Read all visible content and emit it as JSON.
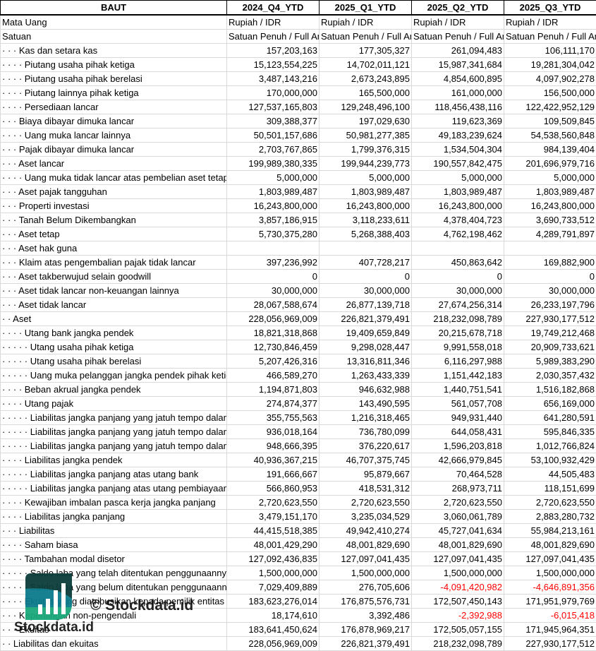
{
  "sheet": {
    "title": "BAUT",
    "columns": [
      "2024_Q4_YTD",
      "2025_Q1_YTD",
      "2025_Q2_YTD",
      "2025_Q3_YTD"
    ],
    "meta_rows": [
      {
        "label": "Mata Uang",
        "values": [
          "Rupiah / IDR",
          "Rupiah / IDR",
          "Rupiah / IDR",
          "Rupiah / IDR"
        ]
      },
      {
        "label": "Satuan",
        "values": [
          "Satuan Penuh / Full Amount",
          "Satuan Penuh / Full Amount",
          "Satuan Penuh / Full Amount",
          "Satuan Penuh / Full Amount"
        ]
      }
    ],
    "rows": [
      {
        "label": "· · · Kas dan setara kas",
        "values": [
          "157,203,163",
          "177,305,327",
          "261,094,483",
          "106,111,170"
        ]
      },
      {
        "label": "· · · · Piutang usaha pihak ketiga",
        "values": [
          "15,123,554,225",
          "14,702,011,121",
          "15,987,341,684",
          "19,281,304,042"
        ]
      },
      {
        "label": "· · · · Piutang usaha pihak berelasi",
        "values": [
          "3,487,143,216",
          "2,673,243,895",
          "4,854,600,895",
          "4,097,902,278"
        ]
      },
      {
        "label": "· · · · Piutang lainnya pihak ketiga",
        "values": [
          "170,000,000",
          "165,500,000",
          "161,000,000",
          "156,500,000"
        ]
      },
      {
        "label": "· · · · Persediaan lancar",
        "values": [
          "127,537,165,803",
          "129,248,496,100",
          "118,456,438,116",
          "122,422,952,129"
        ]
      },
      {
        "label": "· · · Biaya dibayar dimuka lancar",
        "values": [
          "309,388,377",
          "197,029,630",
          "119,623,369",
          "109,509,845"
        ]
      },
      {
        "label": "· · · · Uang muka lancar lainnya",
        "values": [
          "50,501,157,686",
          "50,981,277,385",
          "49,183,239,624",
          "54,538,560,848"
        ]
      },
      {
        "label": "· · · Pajak dibayar dimuka lancar",
        "values": [
          "2,703,767,865",
          "1,799,376,315",
          "1,534,504,304",
          "984,139,404"
        ]
      },
      {
        "label": "· · · Aset lancar",
        "values": [
          "199,989,380,335",
          "199,944,239,773",
          "190,557,842,475",
          "201,696,979,716"
        ]
      },
      {
        "label": "· · · · Uang muka tidak lancar atas pembelian aset tetap",
        "values": [
          "5,000,000",
          "5,000,000",
          "5,000,000",
          "5,000,000"
        ]
      },
      {
        "label": "· · · Aset pajak tangguhan",
        "values": [
          "1,803,989,487",
          "1,803,989,487",
          "1,803,989,487",
          "1,803,989,487"
        ]
      },
      {
        "label": "· · · Properti investasi",
        "values": [
          "16,243,800,000",
          "16,243,800,000",
          "16,243,800,000",
          "16,243,800,000"
        ]
      },
      {
        "label": "· · · Tanah Belum Dikembangkan",
        "values": [
          "3,857,186,915",
          "3,118,233,611",
          "4,378,404,723",
          "3,690,733,512"
        ]
      },
      {
        "label": "· · · Aset tetap",
        "values": [
          "5,730,375,280",
          "5,268,388,403",
          "4,762,198,462",
          "4,289,791,897"
        ]
      },
      {
        "label": "· · · Aset hak guna",
        "values": [
          "",
          "",
          "",
          ""
        ]
      },
      {
        "label": "· · · Klaim atas pengembalian pajak tidak lancar",
        "values": [
          "397,236,992",
          "407,728,217",
          "450,863,642",
          "169,882,900"
        ]
      },
      {
        "label": "· · · Aset takberwujud selain goodwill",
        "values": [
          "0",
          "0",
          "0",
          "0"
        ]
      },
      {
        "label": "· · · Aset tidak lancar non-keuangan lainnya",
        "values": [
          "30,000,000",
          "30,000,000",
          "30,000,000",
          "30,000,000"
        ]
      },
      {
        "label": "· · · Aset tidak lancar",
        "values": [
          "28,067,588,674",
          "26,877,139,718",
          "27,674,256,314",
          "26,233,197,796"
        ]
      },
      {
        "label": "· · Aset",
        "values": [
          "228,056,969,009",
          "226,821,379,491",
          "218,232,098,789",
          "227,930,177,512"
        ]
      },
      {
        "label": "· · · · Utang bank jangka pendek",
        "values": [
          "18,821,318,868",
          "19,409,659,849",
          "20,215,678,718",
          "19,749,212,468"
        ]
      },
      {
        "label": "· · · · · Utang usaha pihak ketiga",
        "values": [
          "12,730,846,459",
          "9,298,028,447",
          "9,991,558,018",
          "20,909,733,621"
        ]
      },
      {
        "label": "· · · · · Utang usaha pihak berelasi",
        "values": [
          "5,207,426,316",
          "13,316,811,346",
          "6,116,297,988",
          "5,989,383,290"
        ]
      },
      {
        "label": "· · · · · Uang muka pelanggan jangka pendek pihak ketiga",
        "values": [
          "466,589,270",
          "1,263,433,339",
          "1,151,442,183",
          "2,030,357,432"
        ]
      },
      {
        "label": "· · · · Beban akrual jangka pendek",
        "values": [
          "1,194,871,803",
          "946,632,988",
          "1,440,751,541",
          "1,516,182,868"
        ]
      },
      {
        "label": "· · · · Utang pajak",
        "values": [
          "274,874,377",
          "143,490,595",
          "561,057,708",
          "656,169,000"
        ]
      },
      {
        "label": "· · · · · Liabilitas jangka panjang yang jatuh tempo dalam satu tahun",
        "values": [
          "355,755,563",
          "1,216,318,465",
          "949,931,440",
          "641,280,591"
        ]
      },
      {
        "label": "· · · · · Liabilitas jangka panjang yang jatuh tempo dalam satu tahun",
        "values": [
          "936,018,164",
          "736,780,099",
          "644,058,431",
          "595,846,335"
        ]
      },
      {
        "label": "· · · · · Liabilitas jangka panjang yang jatuh tempo dalam satu tahun",
        "values": [
          "948,666,395",
          "376,220,617",
          "1,596,203,818",
          "1,012,766,824"
        ]
      },
      {
        "label": "· · · · Liabilitas jangka pendek",
        "values": [
          "40,936,367,215",
          "46,707,375,745",
          "42,666,979,845",
          "53,100,932,429"
        ]
      },
      {
        "label": "· · · · · Liabilitas jangka panjang atas utang bank",
        "values": [
          "191,666,667",
          "95,879,667",
          "70,464,528",
          "44,505,483"
        ]
      },
      {
        "label": "· · · · · Liabilitas jangka panjang atas utang pembiayaan",
        "values": [
          "566,860,953",
          "418,531,312",
          "268,973,711",
          "118,151,699"
        ]
      },
      {
        "label": "· · · · Kewajiban imbalan pasca kerja jangka panjang",
        "values": [
          "2,720,623,550",
          "2,720,623,550",
          "2,720,623,550",
          "2,720,623,550"
        ]
      },
      {
        "label": "· · · · Liabilitas jangka panjang",
        "values": [
          "3,479,151,170",
          "3,235,034,529",
          "3,060,061,789",
          "2,883,280,732"
        ]
      },
      {
        "label": "· · · Liabilitas",
        "values": [
          "44,415,518,385",
          "49,942,410,274",
          "45,727,041,634",
          "55,984,213,161"
        ]
      },
      {
        "label": "· · · · Saham biasa",
        "values": [
          "48,001,429,290",
          "48,001,829,690",
          "48,001,829,690",
          "48,001,829,690"
        ]
      },
      {
        "label": "· · · · Tambahan modal disetor",
        "values": [
          "127,092,436,835",
          "127,097,041,435",
          "127,097,041,435",
          "127,097,041,435"
        ]
      },
      {
        "label": "· · · · · Saldo laba yang telah ditentukan penggunaannya",
        "values": [
          "1,500,000,000",
          "1,500,000,000",
          "1,500,000,000",
          "1,500,000,000"
        ]
      },
      {
        "label": "· · · · · Saldo laba yang belum ditentukan penggunaannya",
        "values": [
          "7,029,409,889",
          "276,705,606",
          "-4,091,420,982",
          "-4,646,891,356"
        ]
      },
      {
        "label": "· · · · Ekuitas yang diatribusikan kepada pemilik entitas induk",
        "values": [
          "183,623,276,014",
          "176,875,576,731",
          "172,507,450,143",
          "171,951,979,769"
        ]
      },
      {
        "label": "· · · Kepentingan non-pengendali",
        "values": [
          "18,174,610",
          "3,392,486",
          "-2,392,988",
          "-6,015,418"
        ]
      },
      {
        "label": "· · · Ekuitas",
        "values": [
          "183,641,450,624",
          "176,878,969,217",
          "172,505,057,155",
          "171,945,964,351"
        ]
      },
      {
        "label": "· · Liabilitas dan ekuitas",
        "values": [
          "228,056,969,009",
          "226,821,379,491",
          "218,232,098,789",
          "227,930,177,512"
        ]
      }
    ]
  },
  "watermark": {
    "brand": "Stockdata.id",
    "copyright": "© Stockdata.id",
    "colors": {
      "dark": "#0b3d3a",
      "teal": "#0b7a8c",
      "green": "#1aa87a"
    }
  },
  "colors": {
    "negative": "#ff0000",
    "grid": "#d9d9d9"
  }
}
